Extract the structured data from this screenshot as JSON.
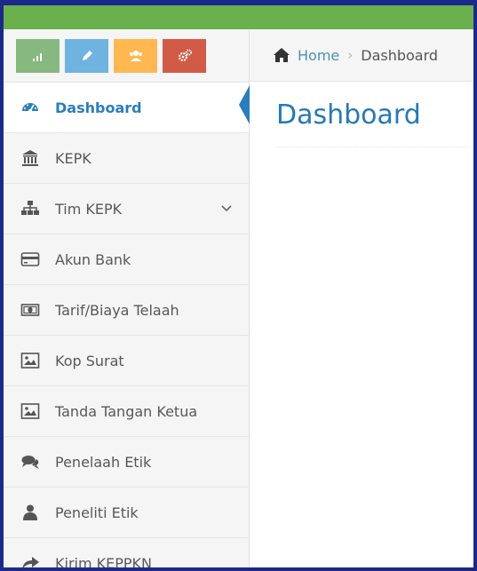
{
  "shortcuts": [
    {
      "icon": "signal-icon",
      "color": "#87b87f"
    },
    {
      "icon": "pencil-icon",
      "color": "#6fb3e0"
    },
    {
      "icon": "users-icon",
      "color": "#ffb752"
    },
    {
      "icon": "cogs-icon",
      "color": "#d15b47"
    }
  ],
  "breadcrumb": {
    "home": "Home",
    "current": "Dashboard"
  },
  "page": {
    "title": "Dashboard"
  },
  "sidebar": {
    "items": [
      {
        "label": "Dashboard",
        "icon": "tachometer-icon",
        "active": true
      },
      {
        "label": "KEPK",
        "icon": "institution-icon"
      },
      {
        "label": "Tim KEPK",
        "icon": "sitemap-icon",
        "has_submenu": true
      },
      {
        "label": "Akun Bank",
        "icon": "credit-card-icon"
      },
      {
        "label": "Tarif/Biaya Telaah",
        "icon": "money-icon"
      },
      {
        "label": "Kop Surat",
        "icon": "picture-icon"
      },
      {
        "label": "Tanda Tangan Ketua",
        "icon": "picture-icon"
      },
      {
        "label": "Penelaah Etik",
        "icon": "comments-icon"
      },
      {
        "label": "Peneliti Etik",
        "icon": "user-icon"
      },
      {
        "label": "Kirim KEPPKN",
        "icon": "share-icon"
      }
    ]
  },
  "colors": {
    "accent": "#2b7dbc",
    "topbar": "#6ab04c",
    "frame": "#1b2a8a"
  }
}
